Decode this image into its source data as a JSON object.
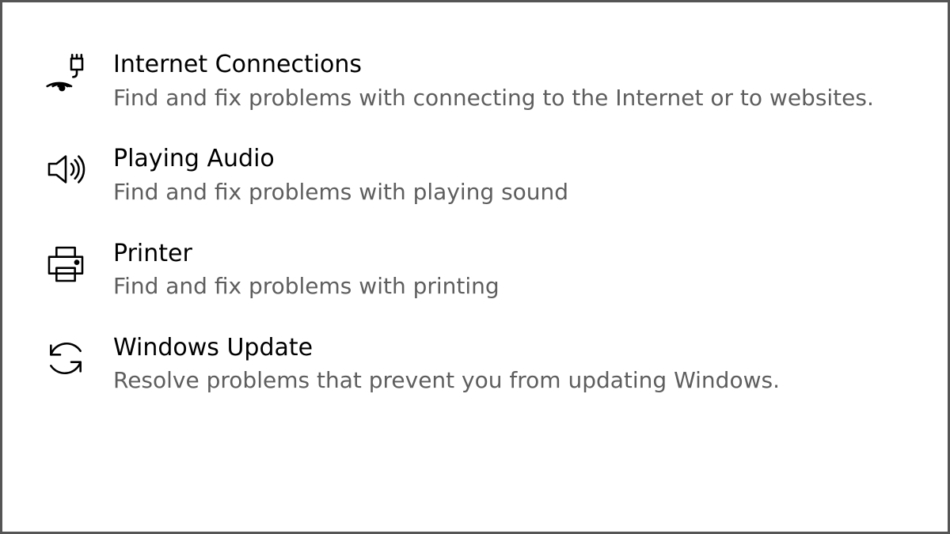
{
  "troubleshooters": [
    {
      "icon": "wifi-network-icon",
      "title": "Internet Connections",
      "description": "Find and fix problems with connecting to the Internet or to websites."
    },
    {
      "icon": "speaker-icon",
      "title": "Playing Audio",
      "description": "Find and fix problems with playing sound"
    },
    {
      "icon": "printer-icon",
      "title": "Printer",
      "description": "Find and fix problems with printing"
    },
    {
      "icon": "update-sync-icon",
      "title": "Windows Update",
      "description": "Resolve problems that prevent you from updating Windows."
    }
  ]
}
